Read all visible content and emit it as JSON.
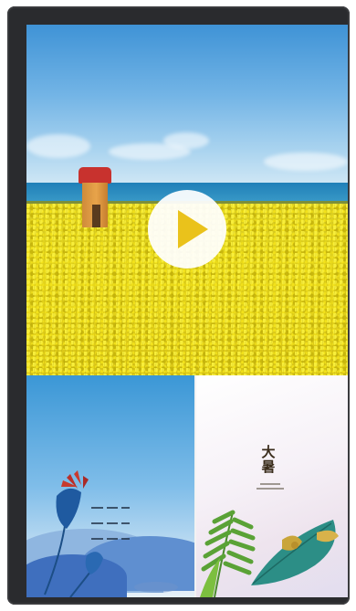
{
  "video": {
    "controls": {
      "play_icon": "play-icon",
      "play_color": "#eac21b"
    }
  },
  "panels": {
    "right": {
      "title_char_1": "大",
      "title_char_2": "暑"
    }
  },
  "colors": {
    "bezel": "#2a2b2e",
    "sky": "#3f93d6",
    "sea": "#1f7fb8",
    "field": "#e6d61c",
    "hut_roof": "#c8322e",
    "hut_body": "#e8a44a"
  }
}
